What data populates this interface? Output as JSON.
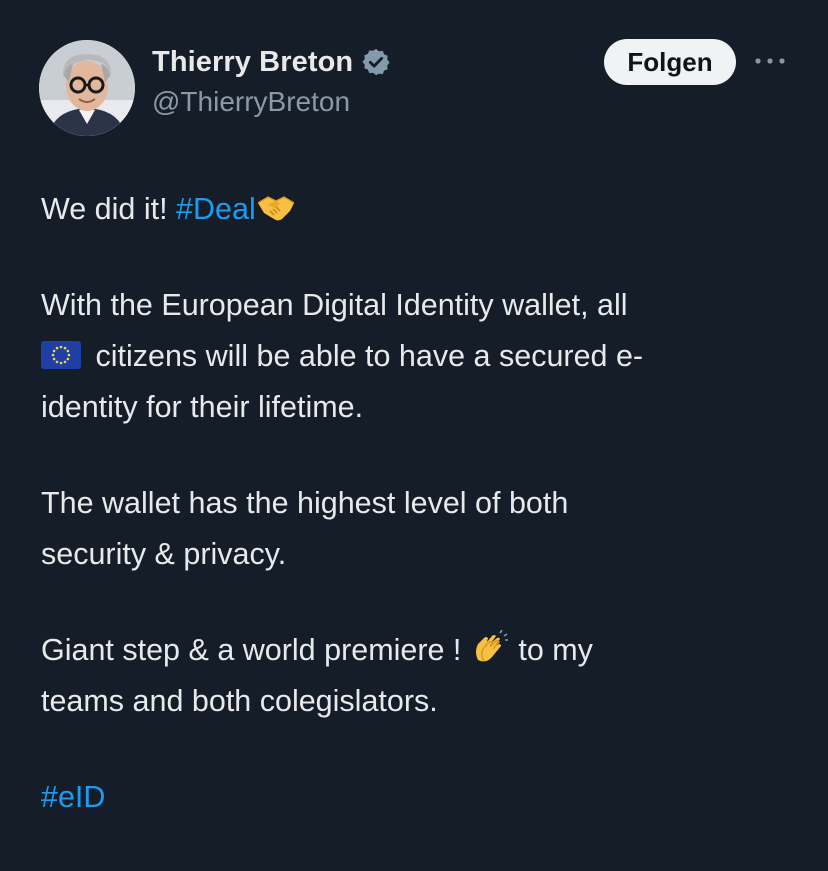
{
  "author": {
    "display_name": "Thierry Breton",
    "handle": "@ThierryBreton",
    "verified": true,
    "avatar_alt": "profile photo"
  },
  "actions": {
    "follow_label": "Folgen",
    "more_icon": "ellipsis-icon"
  },
  "tweet": {
    "line1_text": "We did it! ",
    "line1_hashtag": "#Deal",
    "line1_emoji": "handshake-icon",
    "para2_part1": "With the European Digital Identity wallet, all",
    "para2_emoji": "eu-flag-icon",
    "para2_part2": "citizens will be able to have a secured e-",
    "para2_part3": "identity for their lifetime.",
    "para3_line1": "The wallet has the highest level of both",
    "para3_line2": "security & privacy.",
    "para4_part1": "Giant step & a world premiere ! ",
    "para4_emoji": "clapping-hands-icon",
    "para4_part2": " to my",
    "para4_line2": "teams and both colegislators.",
    "hashtag_final": "#eID"
  },
  "colors": {
    "background": "#151d28",
    "text": "#e7e9ea",
    "secondary_text": "#8b98a5",
    "link": "#1d9bf0",
    "follow_button_bg": "#eff3f4"
  }
}
